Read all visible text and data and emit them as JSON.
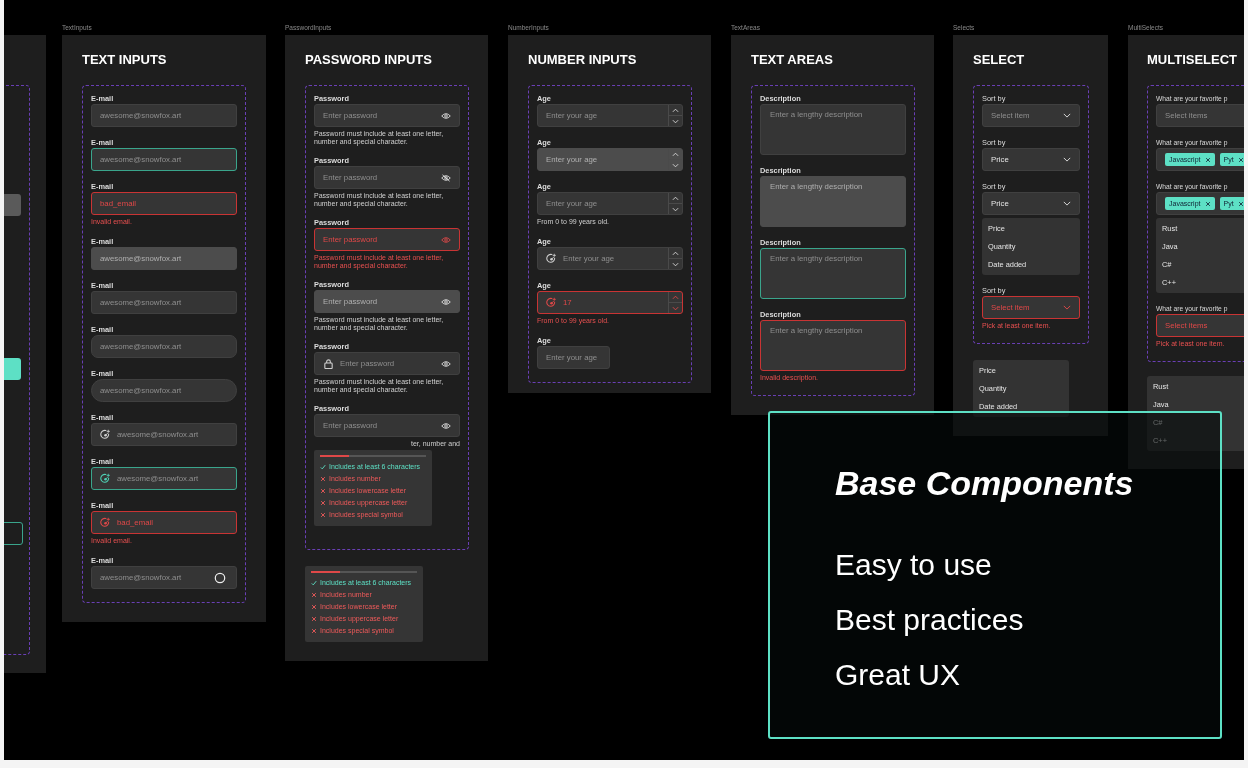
{
  "frames": [
    {
      "kind": "text",
      "caption": "TextInputs",
      "title": "TEXT INPUTS",
      "fields": [
        {
          "label": "E-mail",
          "placeholder": "awesome@snowfox.art",
          "kind": "plain",
          "focused": false,
          "error": false,
          "disabled": false
        },
        {
          "label": "E-mail",
          "placeholder": "awesome@snowfox.art",
          "kind": "plain",
          "focused": true,
          "error": false,
          "disabled": false
        },
        {
          "label": "E-mail",
          "value": "bad_email",
          "kind": "plain",
          "focused": false,
          "error": true,
          "disabled": false,
          "hint": "Invalid email."
        },
        {
          "label": "E-mail",
          "placeholder": "awesome@snowfox.art",
          "kind": "plain",
          "focused": false,
          "error": false,
          "disabled": true
        },
        {
          "label": "E-mail",
          "placeholder": "awesome@snowfox.art",
          "kind": "plain",
          "focused": false,
          "error": false,
          "disabled": false
        },
        {
          "label": "E-mail",
          "placeholder": "awesome@snowfox.art",
          "kind": "rounded",
          "focused": false,
          "error": false,
          "disabled": false
        },
        {
          "label": "E-mail",
          "placeholder": "awesome@snowfox.art",
          "kind": "pill",
          "focused": false,
          "error": false,
          "disabled": false
        },
        {
          "label": "E-mail",
          "placeholder": "awesome@snowfox.art",
          "kind": "icon",
          "focused": false,
          "error": false,
          "disabled": false
        },
        {
          "label": "E-mail",
          "placeholder": "awesome@snowfox.art",
          "kind": "icon",
          "focused": true,
          "error": false,
          "disabled": false
        },
        {
          "label": "E-mail",
          "value": "bad_email",
          "kind": "icon",
          "focused": false,
          "error": true,
          "disabled": false,
          "hint": "Invalid email."
        },
        {
          "label": "E-mail",
          "placeholder": "awesome@snowfox.art",
          "kind": "loading",
          "focused": false,
          "error": false,
          "disabled": false
        }
      ]
    },
    {
      "kind": "password",
      "caption": "PasswordInputs",
      "title": "PASSWORD INPUTS",
      "fields": [
        {
          "label": "Password",
          "placeholder": "Enter password",
          "kind": "plain",
          "error": false,
          "disabled": false,
          "revealed": false,
          "hint": "Password must include at least one letter, number and special character."
        },
        {
          "label": "Password",
          "placeholder": "Enter password",
          "kind": "plain",
          "error": false,
          "disabled": false,
          "revealed": true,
          "hint": "Password must include at least one letter, number and special character."
        },
        {
          "label": "Password",
          "placeholder": "Enter password",
          "kind": "plain",
          "error": true,
          "disabled": false,
          "revealed": false,
          "hint": "Password must include at least one letter, number and special character."
        },
        {
          "label": "Password",
          "placeholder": "Enter password",
          "kind": "plain",
          "error": false,
          "disabled": true,
          "revealed": false,
          "hint": "Password must include at least one letter, number and special character."
        },
        {
          "label": "Password",
          "placeholder": "Enter password",
          "kind": "lock",
          "error": false,
          "disabled": false,
          "revealed": false,
          "hint": "Password must include at least one letter, number and special character."
        },
        {
          "label": "Password",
          "placeholder": "Enter password",
          "kind": "plain",
          "error": false,
          "disabled": false,
          "revealed": false,
          "hint": "ter, number and",
          "popover": {
            "level": 0.27,
            "checks": [
              {
                "text": "Includes at least 6 characters",
                "met": true
              },
              {
                "text": "Includes number",
                "met": false
              },
              {
                "text": "Includes lowercase letter",
                "met": false
              },
              {
                "text": "Includes uppercase letter",
                "met": false
              },
              {
                "text": "Includes special symbol",
                "met": false
              }
            ]
          }
        }
      ],
      "popover": {
        "level": 0.27,
        "checks": [
          {
            "text": "Includes at least 6 characters",
            "met": true
          },
          {
            "text": "Includes number",
            "met": false
          },
          {
            "text": "Includes lowercase letter",
            "met": false
          },
          {
            "text": "Includes uppercase letter",
            "met": false
          },
          {
            "text": "Includes special symbol",
            "met": false
          }
        ]
      }
    },
    {
      "kind": "number",
      "caption": "NumberInputs",
      "title": "NUMBER INPUTS",
      "fields": [
        {
          "label": "Age",
          "placeholder": "Enter your age",
          "kind": "stepper",
          "error": false,
          "disabled": false
        },
        {
          "label": "Age",
          "placeholder": "Enter your age",
          "kind": "stepper",
          "error": false,
          "disabled": true
        },
        {
          "label": "Age",
          "placeholder": "Enter your age",
          "kind": "stepper",
          "error": false,
          "disabled": false,
          "hint": "From 0 to 99 years old."
        },
        {
          "label": "Age",
          "placeholder": "Enter your age",
          "kind": "icon-stepper",
          "error": false,
          "disabled": false
        },
        {
          "label": "Age",
          "value": "17",
          "kind": "icon-stepper",
          "error": true,
          "disabled": false,
          "hint": "From 0 to 99 years old."
        },
        {
          "label": "Age",
          "placeholder": "Enter your age",
          "kind": "plain",
          "error": false,
          "disabled": false
        }
      ]
    },
    {
      "kind": "textarea",
      "caption": "TextAreas",
      "title": "TEXT AREAS",
      "fields": [
        {
          "label": "Description",
          "placeholder": "Enter a lengthy description",
          "focused": false,
          "error": false,
          "disabled": false
        },
        {
          "label": "Description",
          "placeholder": "Enter a lengthy description",
          "focused": false,
          "error": false,
          "disabled": true
        },
        {
          "label": "Description",
          "placeholder": "Enter a lengthy description",
          "focused": true,
          "error": false,
          "disabled": false
        },
        {
          "label": "Description",
          "placeholder": "Enter a lengthy description",
          "focused": false,
          "error": true,
          "disabled": false,
          "hint": "Invalid description."
        }
      ]
    },
    {
      "kind": "select",
      "caption": "Selects",
      "title": "SELECT",
      "fields": [
        {
          "label": "Sort by",
          "placeholder": "Select item",
          "error": false
        },
        {
          "label": "Sort by",
          "value": "Price",
          "error": false
        },
        {
          "label": "Sort by",
          "value": "Price",
          "error": false,
          "options": [
            "Price",
            "Quantity",
            "Date added"
          ]
        },
        {
          "label": "Sort by",
          "placeholder": "Select item",
          "error": true,
          "hint": "Pick at least one item."
        }
      ],
      "dropdown": [
        "Price",
        "Quantity",
        "Date added"
      ]
    },
    {
      "kind": "multiselect",
      "caption": "MultiSelects",
      "title": "MULTISELECT",
      "fields": [
        {
          "label": "What are your favorite p",
          "placeholder": "Select items",
          "error": false
        },
        {
          "label": "What are your favorite p",
          "chips": [
            "Javascript",
            "Pyt"
          ],
          "error": false
        },
        {
          "label": "What are your favorite p",
          "chips": [
            "Javascript",
            "Pyt"
          ],
          "error": false,
          "options": [
            "Rust",
            "Java",
            "C#",
            "C++"
          ]
        },
        {
          "label": "What are your favorite p",
          "placeholder": "Select items",
          "error": true,
          "hint": "Pick at least one item."
        }
      ],
      "dropdown": [
        "Rust",
        "Java",
        "C#",
        "C++"
      ]
    }
  ],
  "promo": {
    "title": "Base Components",
    "points": [
      "Easy to use",
      "Best practices",
      "Great UX"
    ]
  }
}
